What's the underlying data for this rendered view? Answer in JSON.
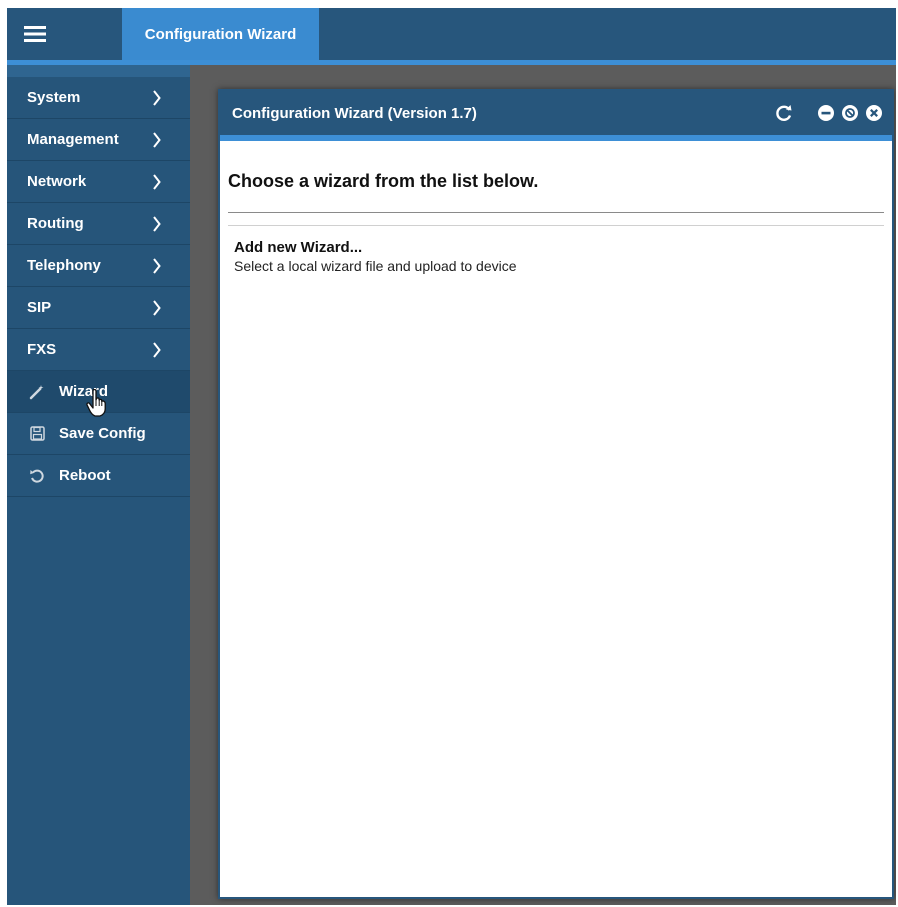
{
  "topbar": {
    "menu_icon": "hamburger-icon",
    "tab_label": "Configuration Wizard"
  },
  "sidebar": {
    "items": [
      {
        "label": "System",
        "icon": "chevron-right-icon"
      },
      {
        "label": "Management",
        "icon": "chevron-right-icon"
      },
      {
        "label": "Network",
        "icon": "chevron-right-icon"
      },
      {
        "label": "Routing",
        "icon": "chevron-right-icon"
      },
      {
        "label": "Telephony",
        "icon": "chevron-right-icon"
      },
      {
        "label": "SIP",
        "icon": "chevron-right-icon"
      },
      {
        "label": "FXS",
        "icon": "chevron-right-icon"
      },
      {
        "label": "Wizard",
        "icon": "magic-wand-icon"
      },
      {
        "label": "Save Config",
        "icon": "floppy-disk-icon"
      },
      {
        "label": "Reboot",
        "icon": "restart-icon"
      }
    ]
  },
  "window": {
    "title": "Configuration Wizard (Version 1.7)",
    "controls": [
      "refresh-icon",
      "minimize-icon",
      "restore-icon",
      "close-icon"
    ],
    "heading": "Choose a wizard from the list below.",
    "wizards": [
      {
        "title": "Add new Wizard...",
        "description": "Select a local wizard file and upload to device"
      }
    ]
  },
  "colors": {
    "bar": "#27567c",
    "accent": "#3d8fd6",
    "tab": "#3a8bd0",
    "background": "#5c5c5c"
  }
}
